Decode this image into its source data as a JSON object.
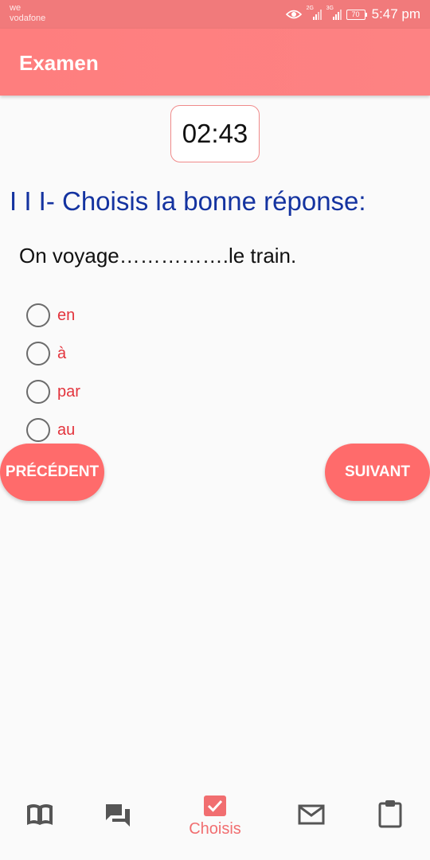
{
  "status_bar": {
    "carrier_line1": "we",
    "carrier_line2": "vodafone",
    "sim1_label": "2G",
    "sim2_label": "3G",
    "battery": "70",
    "time": "5:47 pm",
    "icons": [
      "eye-icon",
      "signal-icon",
      "signal-icon",
      "battery-icon"
    ]
  },
  "app_bar": {
    "title": "Examen"
  },
  "timer": "02:43",
  "section_title": "I I I- Choisis la bonne réponse:",
  "question": "On voyage…………….le train.",
  "options": [
    {
      "label": "en"
    },
    {
      "label": "à"
    },
    {
      "label": "par"
    },
    {
      "label": "au"
    }
  ],
  "buttons": {
    "previous": "PRÉCÉDENT",
    "next": "SUIVANT"
  },
  "bottom_nav": {
    "items": [
      {
        "icon": "book-icon",
        "label": ""
      },
      {
        "icon": "chat-icon",
        "label": ""
      },
      {
        "icon": "checkbox-icon",
        "label": "Choisis",
        "active": true
      },
      {
        "icon": "mail-icon",
        "label": ""
      },
      {
        "icon": "clipboard-icon",
        "label": ""
      }
    ]
  },
  "colors": {
    "status_bar": "#f17a7b",
    "app_bar": "#fe7e7e",
    "button": "#ff6b6b",
    "section_title": "#1433a0",
    "option_text": "#e3343d",
    "nav_active": "#f16e70",
    "nav_icon": "#555555"
  }
}
